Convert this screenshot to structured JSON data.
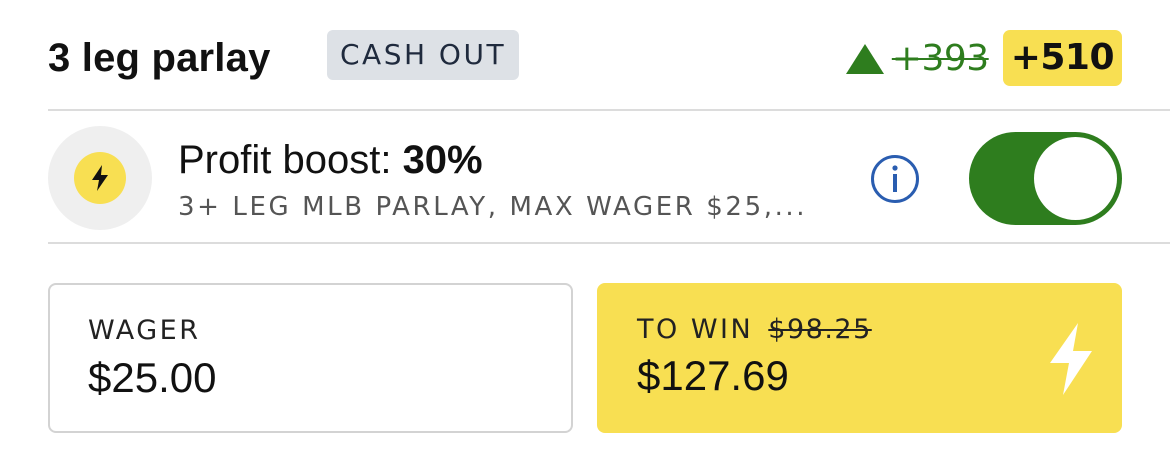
{
  "header": {
    "title": "3 leg parlay",
    "badge": "CASH OUT",
    "old_odds": "+393",
    "new_odds": "+510",
    "colors": {
      "odds_up": "#2e7d1e",
      "boosted_bg": "#f8df52"
    },
    "arrow_icon": "up-triangle-icon"
  },
  "boost": {
    "title_prefix": "Profit boost: ",
    "percent": "30%",
    "subtitle": "3+ LEG MLB PARLAY, MAX WAGER $25,...",
    "icon": "lightning-bolt-icon",
    "info_icon": "info-icon",
    "enabled": true,
    "colors": {
      "toggle_on": "#2e7d1e",
      "icon_bg": "#f8df52"
    }
  },
  "wager": {
    "label": "WAGER",
    "value": "$25.00"
  },
  "to_win": {
    "label": "TO WIN",
    "old_value": "$98.25",
    "value": "$127.69",
    "icon": "lightning-bolt-icon",
    "color": "#f8df52"
  }
}
